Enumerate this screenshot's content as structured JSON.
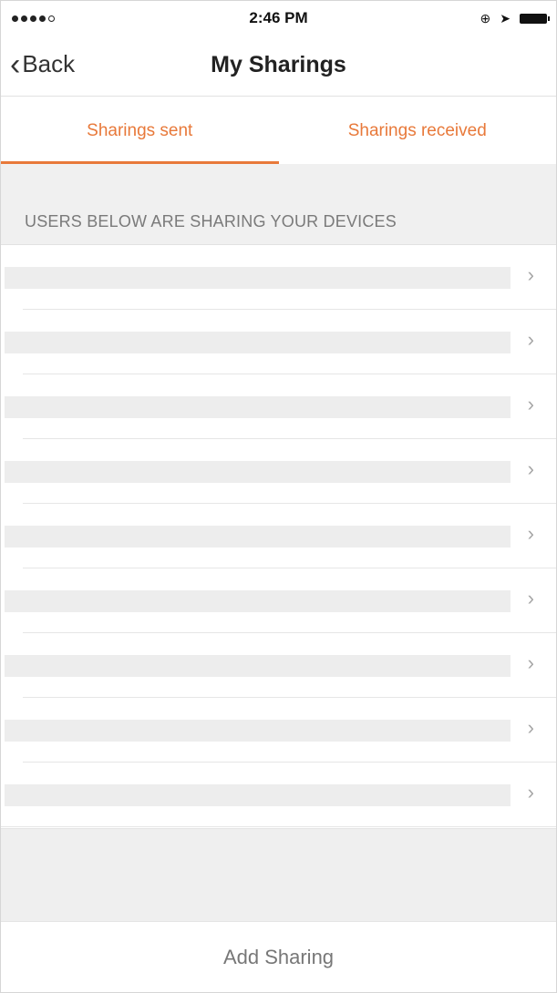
{
  "status_bar": {
    "time": "2:46 PM",
    "icons": [
      "signal-dots-icon",
      "rotation-lock-icon",
      "location-arrow-icon",
      "battery-icon"
    ]
  },
  "nav": {
    "back_label": "Back",
    "title": "My Sharings"
  },
  "tabs": [
    {
      "label": "Sharings sent",
      "active": true
    },
    {
      "label": "Sharings received",
      "active": false
    }
  ],
  "section": {
    "header": "USERS BELOW ARE SHARING YOUR DEVICES"
  },
  "list": {
    "row_count": 9
  },
  "footer": {
    "add_label": "Add Sharing"
  },
  "colors": {
    "accent": "#e8793a",
    "background_gray": "#f0f0f0"
  }
}
